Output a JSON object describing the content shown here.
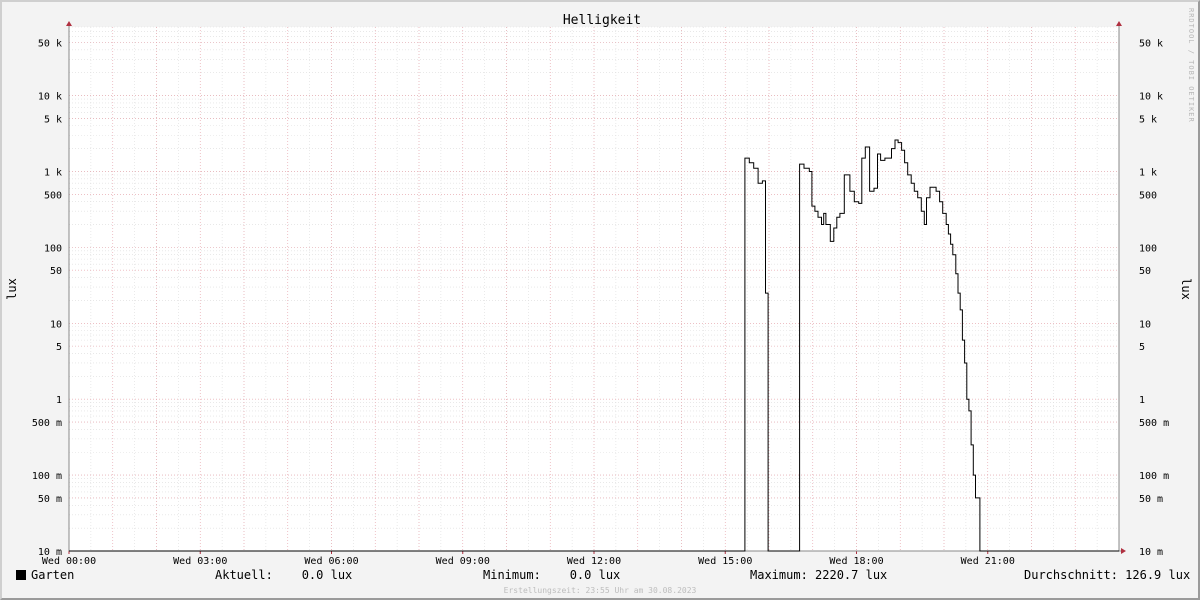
{
  "chart_data": {
    "type": "line",
    "title": "Helligkeit",
    "ylabel": "lux",
    "yscale": "log",
    "ylim": [
      0.01,
      80000
    ],
    "xlim_hours": [
      0,
      24
    ],
    "x_tick_labels": [
      "Wed 00:00",
      "Wed 03:00",
      "Wed 06:00",
      "Wed 09:00",
      "Wed 12:00",
      "Wed 15:00",
      "Wed 18:00",
      "Wed 21:00"
    ],
    "x_tick_hours": [
      0,
      3,
      6,
      9,
      12,
      15,
      18,
      21
    ],
    "y_ticks": [
      {
        "value": 0.01,
        "label": "10 m"
      },
      {
        "value": 0.05,
        "label": "50 m"
      },
      {
        "value": 0.1,
        "label": "100 m"
      },
      {
        "value": 0.5,
        "label": "500 m"
      },
      {
        "value": 1,
        "label": "1"
      },
      {
        "value": 5,
        "label": "5"
      },
      {
        "value": 10,
        "label": "10"
      },
      {
        "value": 50,
        "label": "50"
      },
      {
        "value": 100,
        "label": "100"
      },
      {
        "value": 500,
        "label": "500"
      },
      {
        "value": 1000,
        "label": "1 k"
      },
      {
        "value": 5000,
        "label": "5 k"
      },
      {
        "value": 10000,
        "label": "10 k"
      },
      {
        "value": 50000,
        "label": "50 k"
      }
    ],
    "grid": true,
    "series": [
      {
        "name": "Garten",
        "color": "#000000",
        "points": [
          [
            0,
            0.01
          ],
          [
            15.45,
            0.01
          ],
          [
            15.45,
            1500
          ],
          [
            15.55,
            1500
          ],
          [
            15.55,
            1300
          ],
          [
            15.65,
            1300
          ],
          [
            15.65,
            1100
          ],
          [
            15.75,
            1100
          ],
          [
            15.75,
            700
          ],
          [
            15.85,
            700
          ],
          [
            15.85,
            750
          ],
          [
            15.92,
            750
          ],
          [
            15.92,
            25
          ],
          [
            15.98,
            25
          ],
          [
            15.98,
            0.01
          ],
          [
            16.7,
            0.01
          ],
          [
            16.7,
            1250
          ],
          [
            16.8,
            1250
          ],
          [
            16.8,
            1100
          ],
          [
            16.92,
            1100
          ],
          [
            16.92,
            1000
          ],
          [
            16.98,
            1000
          ],
          [
            16.98,
            350
          ],
          [
            17.05,
            350
          ],
          [
            17.05,
            300
          ],
          [
            17.12,
            300
          ],
          [
            17.12,
            250
          ],
          [
            17.2,
            250
          ],
          [
            17.2,
            200
          ],
          [
            17.25,
            200
          ],
          [
            17.25,
            280
          ],
          [
            17.3,
            280
          ],
          [
            17.3,
            200
          ],
          [
            17.4,
            200
          ],
          [
            17.4,
            120
          ],
          [
            17.48,
            120
          ],
          [
            17.48,
            180
          ],
          [
            17.55,
            180
          ],
          [
            17.55,
            250
          ],
          [
            17.62,
            250
          ],
          [
            17.62,
            280
          ],
          [
            17.72,
            280
          ],
          [
            17.72,
            900
          ],
          [
            17.85,
            900
          ],
          [
            17.85,
            550
          ],
          [
            17.95,
            550
          ],
          [
            17.95,
            400
          ],
          [
            18.05,
            400
          ],
          [
            18.05,
            380
          ],
          [
            18.12,
            380
          ],
          [
            18.12,
            1500
          ],
          [
            18.2,
            1500
          ],
          [
            18.2,
            2100
          ],
          [
            18.3,
            2100
          ],
          [
            18.3,
            550
          ],
          [
            18.4,
            550
          ],
          [
            18.4,
            600
          ],
          [
            18.48,
            600
          ],
          [
            18.48,
            1700
          ],
          [
            18.55,
            1700
          ],
          [
            18.55,
            1400
          ],
          [
            18.65,
            1400
          ],
          [
            18.65,
            1500
          ],
          [
            18.8,
            1500
          ],
          [
            18.8,
            2000
          ],
          [
            18.88,
            2000
          ],
          [
            18.88,
            2600
          ],
          [
            18.95,
            2600
          ],
          [
            18.95,
            2400
          ],
          [
            19.03,
            2400
          ],
          [
            19.03,
            1900
          ],
          [
            19.1,
            1900
          ],
          [
            19.1,
            1300
          ],
          [
            19.17,
            1300
          ],
          [
            19.17,
            900
          ],
          [
            19.25,
            900
          ],
          [
            19.25,
            700
          ],
          [
            19.32,
            700
          ],
          [
            19.32,
            550
          ],
          [
            19.4,
            550
          ],
          [
            19.4,
            450
          ],
          [
            19.48,
            450
          ],
          [
            19.48,
            300
          ],
          [
            19.55,
            300
          ],
          [
            19.55,
            200
          ],
          [
            19.6,
            200
          ],
          [
            19.6,
            450
          ],
          [
            19.68,
            450
          ],
          [
            19.68,
            620
          ],
          [
            19.82,
            620
          ],
          [
            19.82,
            550
          ],
          [
            19.9,
            550
          ],
          [
            19.9,
            400
          ],
          [
            19.97,
            400
          ],
          [
            19.97,
            280
          ],
          [
            20.05,
            280
          ],
          [
            20.05,
            200
          ],
          [
            20.1,
            200
          ],
          [
            20.1,
            150
          ],
          [
            20.15,
            150
          ],
          [
            20.15,
            110
          ],
          [
            20.2,
            110
          ],
          [
            20.2,
            80
          ],
          [
            20.27,
            80
          ],
          [
            20.27,
            45
          ],
          [
            20.32,
            45
          ],
          [
            20.32,
            25
          ],
          [
            20.37,
            25
          ],
          [
            20.37,
            15
          ],
          [
            20.42,
            15
          ],
          [
            20.42,
            6
          ],
          [
            20.47,
            6
          ],
          [
            20.47,
            3
          ],
          [
            20.52,
            3
          ],
          [
            20.52,
            1
          ],
          [
            20.57,
            1
          ],
          [
            20.57,
            0.7
          ],
          [
            20.62,
            0.7
          ],
          [
            20.62,
            0.25
          ],
          [
            20.67,
            0.25
          ],
          [
            20.67,
            0.1
          ],
          [
            20.72,
            0.1
          ],
          [
            20.72,
            0.05
          ],
          [
            20.82,
            0.05
          ],
          [
            20.82,
            0.01
          ],
          [
            24,
            0.01
          ]
        ]
      }
    ]
  },
  "footer": {
    "legend_label": "Garten",
    "legend_color": "#000000",
    "current": "Aktuell:    0.0 lux",
    "minimum": "Minimum:    0.0 lux",
    "maximum": "Maximum: 2220.7 lux",
    "average": "Durchschnitt: 126.9 lux",
    "created": "Erstellungszeit: 23:55 Uhr am 30.08.2023"
  },
  "watermark": "RRDTOOL / TOBI OETIKER"
}
